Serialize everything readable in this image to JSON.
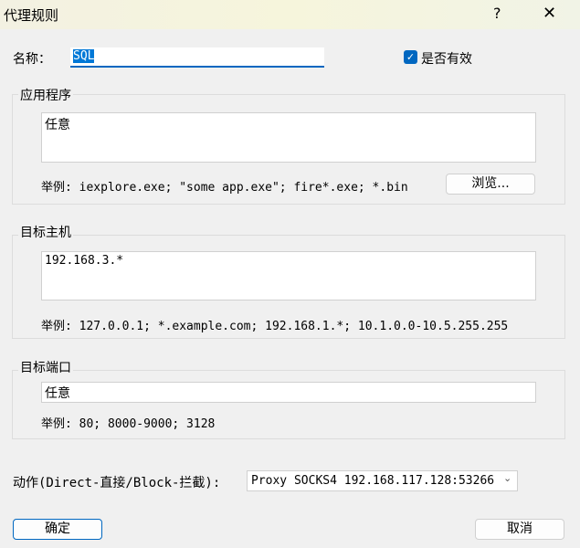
{
  "window": {
    "title": "代理规则",
    "help": "?",
    "close": "✕"
  },
  "name": {
    "label": "名称：",
    "value": "SQL"
  },
  "enabled": {
    "label": "是否有效",
    "checked": true
  },
  "app": {
    "legend": "应用程序",
    "value": "任意",
    "example": "举例: iexplore.exe; \"some app.exe\"; fire*.exe; *.bin",
    "browse": "浏览..."
  },
  "host": {
    "legend": "目标主机",
    "value": "192.168.3.*",
    "example": "举例: 127.0.0.1; *.example.com; 192.168.1.*; 10.1.0.0-10.5.255.255"
  },
  "port": {
    "legend": "目标端口",
    "value": "任意",
    "example": "举例: 80; 8000-9000; 3128"
  },
  "action": {
    "label": "动作(Direct-直接/Block-拦截):",
    "selected": "Proxy SOCKS4 192.168.117.128:53266"
  },
  "buttons": {
    "ok": "确定",
    "cancel": "取消"
  },
  "colors": {
    "accent": "#0067c0"
  }
}
